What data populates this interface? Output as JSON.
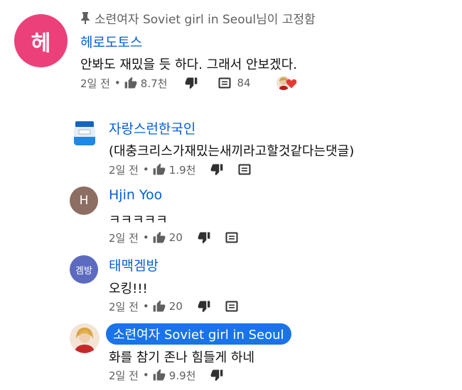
{
  "pinned_text": "소련여자 Soviet girl in Seoul님이 고정함",
  "main_comment": {
    "avatar_letter": "헤",
    "author": "헤로도토스",
    "text": "안봐도 재밌을 듯 하다. 그래서 안보겠다.",
    "time": "2일 전",
    "likes": "8.7천",
    "reply_count": "84"
  },
  "replies": [
    {
      "author": "자랑스런한국인",
      "text": "(대충크리스가재밌는새끼라고할것같다는댓글)",
      "time": "2일 전",
      "likes": "1.9천"
    },
    {
      "avatar_letter": "H",
      "author": "Hjin Yoo",
      "text": "ㅋㅋㅋㅋㅋ",
      "time": "2일 전",
      "likes": "20"
    },
    {
      "avatar_letter": "겜방",
      "author": "태맥겜방",
      "text": "오킹!!!",
      "time": "2일 전",
      "likes": "20"
    },
    {
      "author": "소련여자 Soviet girl in Seoul",
      "text": "화를 참기 존나 힘들게 하네",
      "time": "2일 전",
      "likes": "9.9천"
    }
  ],
  "icons": {
    "pin": "pin-icon",
    "like": "thumb-up-icon",
    "dislike": "thumb-down-icon",
    "reply": "comment-icon",
    "creator_heart": "creator-heart-icon"
  },
  "colors": {
    "author_link": "#065fd4",
    "owner_chip": "#1a73e8",
    "secondary_text": "#606060",
    "main_avatar": "#ec407a",
    "heart": "#e53935"
  }
}
